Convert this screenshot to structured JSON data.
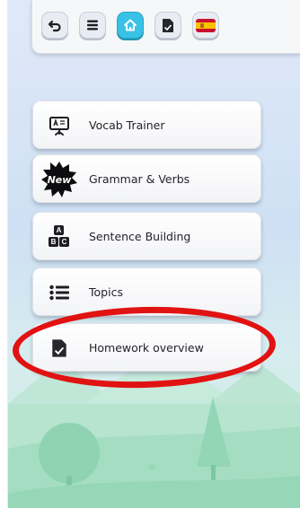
{
  "toolbar": {
    "buttons": [
      {
        "name": "undo",
        "icon": "undo-icon"
      },
      {
        "name": "menu",
        "icon": "hamburger-menu-icon"
      },
      {
        "name": "home",
        "icon": "home-icon",
        "active": true,
        "color": "#39c2e6"
      },
      {
        "name": "homework",
        "icon": "document-check-icon"
      },
      {
        "name": "language",
        "icon": "spain-flag-icon"
      }
    ]
  },
  "menu": {
    "items": [
      {
        "label": "Vocab Trainer",
        "icon": "vocab-board-icon"
      },
      {
        "label": "Grammar & Verbs",
        "icon": "new-badge-icon",
        "badge": "New"
      },
      {
        "label": "Sentence Building",
        "icon": "abc-blocks-icon",
        "letters": [
          "A",
          "B",
          "C"
        ]
      },
      {
        "label": "Topics",
        "icon": "list-icon"
      },
      {
        "label": "Homework overview",
        "icon": "document-check-icon"
      }
    ]
  },
  "annotation": {
    "highlight_color": "#e11212"
  }
}
